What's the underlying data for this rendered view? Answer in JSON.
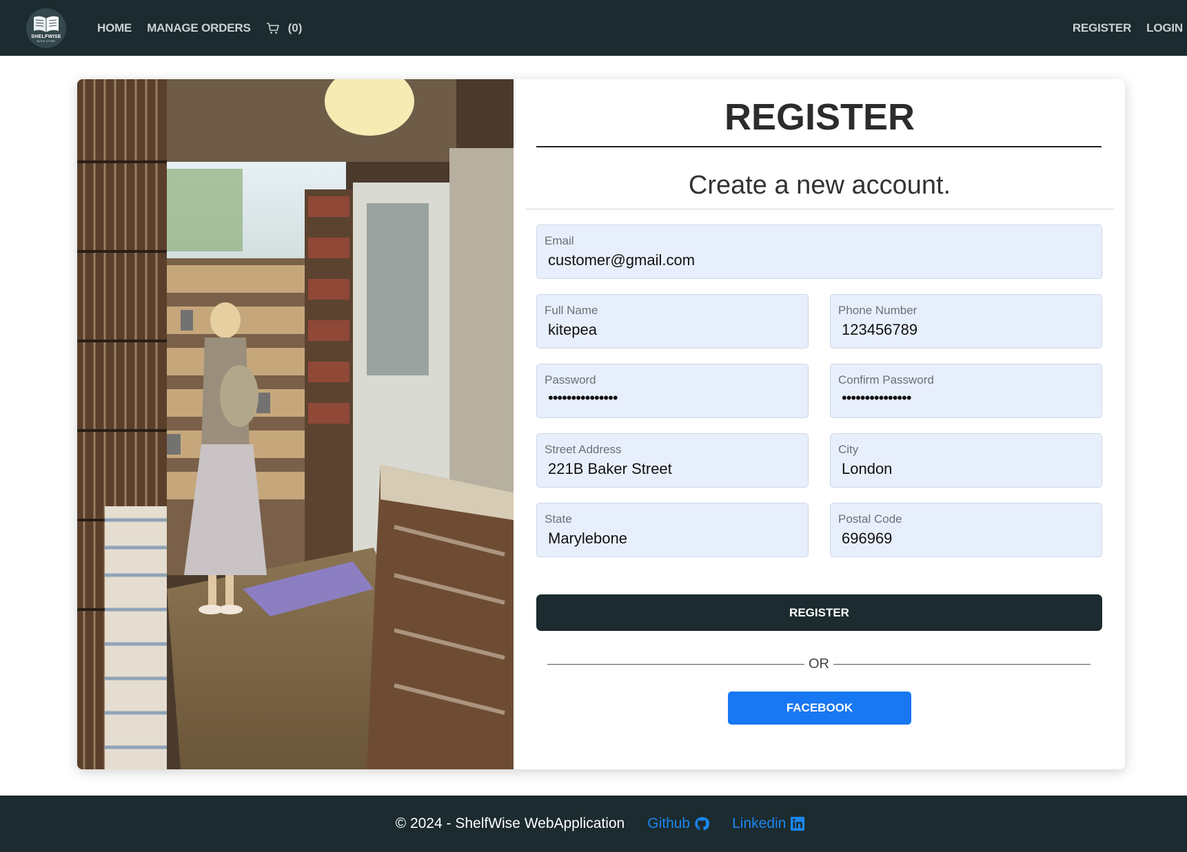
{
  "navbar": {
    "logo_text": "SHELFWISE",
    "logo_sub": "BOOK STORE",
    "home": "HOME",
    "manage_orders": "MANAGE ORDERS",
    "cart_count": "(0)",
    "register": "REGISTER",
    "login": "LOGIN"
  },
  "form": {
    "title": "REGISTER",
    "subtitle": "Create a new account.",
    "email": {
      "label": "Email",
      "value": "customer@gmail.com"
    },
    "full_name": {
      "label": "Full Name",
      "value": "kitepea"
    },
    "phone": {
      "label": "Phone Number",
      "value": "123456789"
    },
    "password": {
      "label": "Password",
      "value": "•••••••••••••••"
    },
    "confirm_password": {
      "label": "Confirm Password",
      "value": "•••••••••••••••"
    },
    "street": {
      "label": "Street Address",
      "value": "221B Baker Street"
    },
    "city": {
      "label": "City",
      "value": "London"
    },
    "state": {
      "label": "State",
      "value": "Marylebone"
    },
    "postal": {
      "label": "Postal Code",
      "value": "696969"
    },
    "register_button": "REGISTER",
    "or_text": "OR",
    "facebook_button": "FACEBOOK"
  },
  "footer": {
    "copyright": "© 2024 - ShelfWise WebApplication",
    "github": "Github",
    "linkedin": "Linkedin"
  },
  "colors": {
    "navbar_bg": "#1b2b2f",
    "field_bg": "#e8effc",
    "facebook_blue": "#1877f2",
    "link_blue": "#1c86ee"
  },
  "icons": [
    "cart-icon",
    "github-icon",
    "linkedin-icon",
    "book-logo-icon"
  ]
}
